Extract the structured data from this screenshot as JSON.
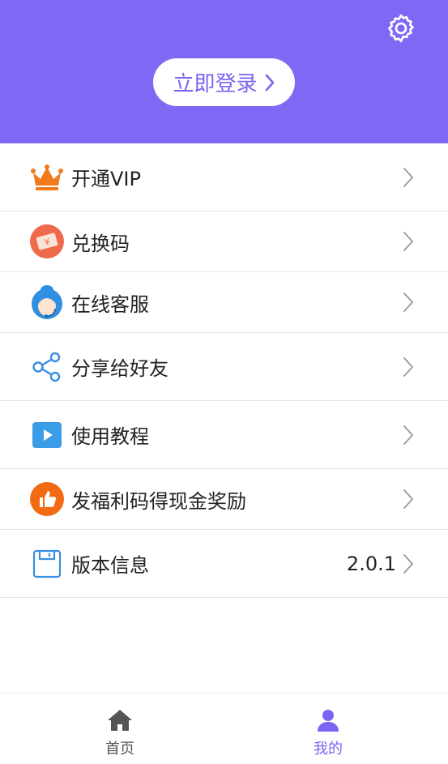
{
  "header": {
    "login_label": "立即登录",
    "colors": {
      "background": "#8068f5",
      "accent": "#7c63f2"
    }
  },
  "menu": {
    "items": [
      {
        "key": "vip",
        "label": "开通VIP",
        "icon": "crown-icon",
        "value": ""
      },
      {
        "key": "redeem",
        "label": "兑换码",
        "icon": "ticket-icon",
        "value": ""
      },
      {
        "key": "support",
        "label": "在线客服",
        "icon": "headset-agent-icon",
        "value": ""
      },
      {
        "key": "share",
        "label": "分享给好友",
        "icon": "share-icon",
        "value": ""
      },
      {
        "key": "tutorial",
        "label": "使用教程",
        "icon": "play-icon",
        "value": ""
      },
      {
        "key": "reward",
        "label": "发福利码得现金奖励",
        "icon": "thumbs-up-icon",
        "value": ""
      },
      {
        "key": "version",
        "label": "版本信息",
        "icon": "floppy-disk-icon",
        "value": "2.0.1"
      }
    ]
  },
  "bottom_nav": {
    "items": [
      {
        "label": "首页",
        "icon": "home-icon",
        "active": false
      },
      {
        "label": "我的",
        "icon": "user-icon",
        "active": true
      }
    ],
    "colors": {
      "active": "#7c63f2",
      "inactive": "#555555"
    }
  }
}
